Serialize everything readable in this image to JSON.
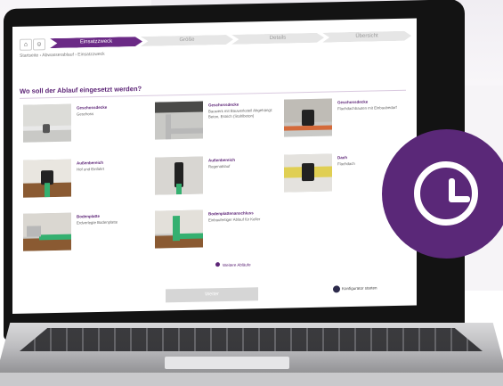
{
  "header": {
    "home_icon": "home-icon",
    "user_icon": "user-icon",
    "steps": [
      {
        "label": "Einsatzzweck",
        "active": true
      },
      {
        "label": "Größe",
        "active": false
      },
      {
        "label": "Details",
        "active": false
      },
      {
        "label": "Übersicht",
        "active": false
      }
    ]
  },
  "breadcrumb": "Startseite › Abwasserablauf › Einsatzzweck",
  "question": "Wo soll der Ablauf eingesetzt werden?",
  "tiles": [
    {
      "title": "Geschossdecke",
      "desc": "Geschoss"
    },
    {
      "title": "Geschossdecke",
      "desc": "Bauwerk mit Bauwerksteil Abgehängt: Beton, Estrich (Stahlbeton)"
    },
    {
      "title": "Geschossdecke",
      "desc": "Flachdachbauten mit Einbaubedarf"
    },
    {
      "title": "Außenbereich",
      "desc": "Hof und Einfahrt"
    },
    {
      "title": "Außenbereich",
      "desc": "Regenablauf"
    },
    {
      "title": "Dach",
      "desc": "Flachdach"
    },
    {
      "title": "Bodenplatte",
      "desc": "Erdverlegte Bodenplatte"
    },
    {
      "title": "Bodenplattenanschluss",
      "desc": "Einbaufertiger Ablauf für Keller"
    }
  ],
  "more_link": "Weitere Abläufe",
  "next_button": "Weiter",
  "configurator_link": "Konfigurator starten",
  "colors": {
    "brand": "#5d2577",
    "accent": "#6b2a86",
    "clock": "#5a2878"
  },
  "badge_icon": "clock-icon"
}
